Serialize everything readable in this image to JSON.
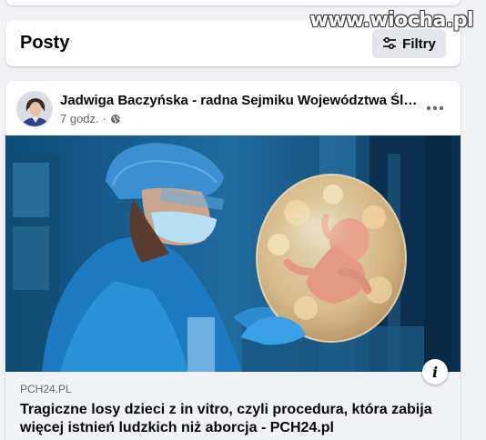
{
  "watermark": "www.wiocha.pl",
  "header": {
    "title": "Posty",
    "filter_label": "Filtry",
    "filter_icon": "sliders-icon"
  },
  "post": {
    "author": "Jadwiga Baczyńska - radna Sejmiku Województwa Śląskiego",
    "time": "7 godz.",
    "separator": "·",
    "privacy_icon": "globe-icon",
    "more_icon": "more-horizontal-icon",
    "info_icon": "info-icon",
    "image_icon": "illustration-doctor-with-baby-in-bubble",
    "link": {
      "domain": "PCH24.PL",
      "title": "Tragiczne losy dzieci z in vitro, czyli procedura, która zabija więcej istnień ludzkich niż aborcja - PCH24.pl"
    }
  },
  "colors": {
    "background": "#f0f2f5",
    "card": "#ffffff",
    "secondary_text": "#65676b",
    "button_bg": "#e4e6eb"
  }
}
